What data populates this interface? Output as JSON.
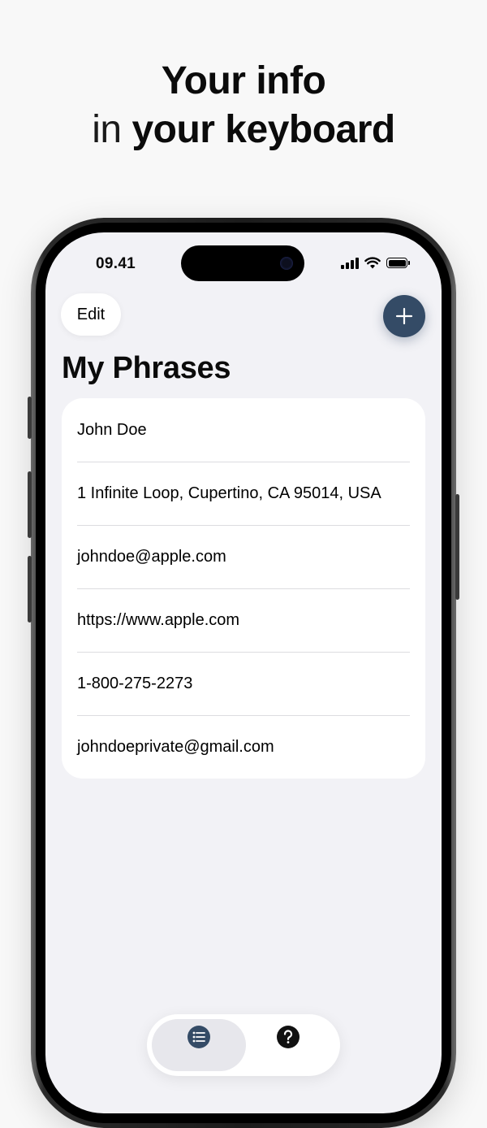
{
  "headline": {
    "line1": "Your info",
    "line2_light": "in ",
    "line2_bold": "your keyboard"
  },
  "status_bar": {
    "time": "09.41"
  },
  "nav": {
    "edit_label": "Edit",
    "add_icon": "plus-icon"
  },
  "page": {
    "title": "My Phrases"
  },
  "phrases": [
    "John Doe",
    "1 Infinite Loop, Cupertino, CA 95014, USA",
    "johndoe@apple.com",
    "https://www.apple.com",
    "1-800-275-2273",
    "johndoeprivate@gmail.com"
  ],
  "tab_bar": {
    "tabs": [
      {
        "icon": "list-icon",
        "active": true
      },
      {
        "icon": "question-icon",
        "active": false
      }
    ]
  },
  "colors": {
    "accent": "#344b66",
    "screen_background": "#f2f2f6",
    "card_background": "#ffffff"
  }
}
